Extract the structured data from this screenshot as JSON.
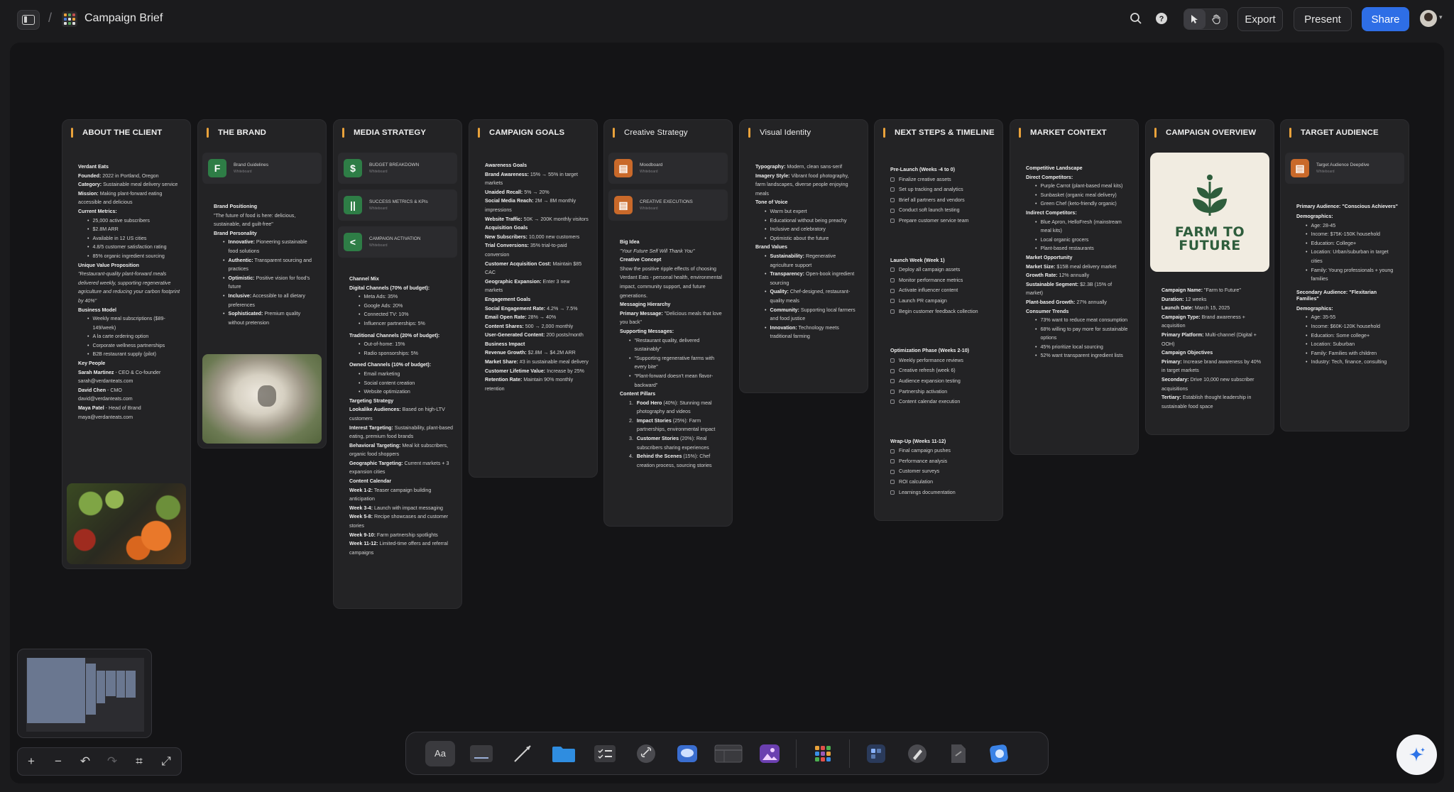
{
  "topbar": {
    "title": "Campaign Brief",
    "separator": "/",
    "export_label": "Export",
    "present_label": "Present",
    "share_label": "Share"
  },
  "cards": {
    "about": {
      "title": "ABOUT THE CLIENT",
      "lines": [
        {
          "b": "Verdant Eats",
          "t": ""
        },
        {
          "b": "Founded:",
          "t": " 2022 in Portland, Oregon"
        },
        {
          "b": "Category:",
          "t": " Sustainable meal delivery service"
        },
        {
          "b": "Mission:",
          "t": " Making plant-forward eating accessible and delicious"
        },
        {
          "b": "Current Metrics:",
          "t": ""
        }
      ],
      "metrics": [
        "25,000 active subscribers",
        "$2.8M ARR",
        "Available in 12 US cities",
        "4.8/5 customer satisfaction rating",
        "85% organic ingredient sourcing"
      ],
      "uvp_label": "Unique Value Proposition",
      "uvp_text": "\"Restaurant-quality plant-forward meals delivered weekly, supporting regenerative agriculture and reducing your carbon footprint by 40%\"",
      "bm_label": "Business Model",
      "business_model": [
        "Weekly meal subscriptions ($89-149/week)",
        "A la carte ordering option",
        "Corporate wellness partnerships",
        "B2B restaurant supply (pilot)"
      ],
      "people_label": "Key People",
      "people": [
        {
          "name": "Sarah Martinez",
          "role": " - CEO & Co-founder",
          "email": "sarah@verdanteats.com"
        },
        {
          "name": "David Chen",
          "role": " - CMO",
          "email": "david@verdanteats.com"
        },
        {
          "name": "Maya Patel",
          "role": " - Head of Brand",
          "email": "maya@verdanteats.com"
        }
      ]
    },
    "brand": {
      "title": "THE BRAND",
      "attachment": {
        "name": "Brand Guidelines",
        "type": "Whiteboard"
      },
      "positioning_label": "Brand Positioning",
      "positioning_text": "\"The future of food is here: delicious, sustainable, and guilt-free\"",
      "personality_label": "Brand Personality",
      "traits": [
        {
          "b": "Innovative:",
          "t": " Pioneering sustainable food solutions"
        },
        {
          "b": "Authentic:",
          "t": " Transparent sourcing and practices"
        },
        {
          "b": "Optimistic:",
          "t": " Positive vision for food's future"
        },
        {
          "b": "Inclusive:",
          "t": " Accessible to all dietary preferences"
        },
        {
          "b": "Sophisticated:",
          "t": " Premium quality without pretension"
        }
      ]
    },
    "media": {
      "title": "MEDIA STRATEGY",
      "attachments": [
        {
          "name": "BUDGET BREAKDOWN",
          "type": "Whiteboard",
          "icon": "$"
        },
        {
          "name": "SUCCESS METRICS & KPIs",
          "type": "Whiteboard",
          "icon": "||"
        },
        {
          "name": "CAMPAIGN ACTIVATION",
          "type": "Whiteboard",
          "icon": "<"
        }
      ],
      "channel_mix_label": "Channel Mix",
      "digital_label": "Digital Channels (70% of budget):",
      "digital": [
        "Meta Ads: 35%",
        "Google Ads: 20%",
        "Connected TV: 10%",
        "Influencer partnerships: 5%"
      ],
      "traditional_label": "Traditional Channels (20% of budget):",
      "traditional": [
        "Out-of-home: 15%",
        "Radio sponsorships: 5%"
      ],
      "owned_label": "Owned Channels (10% of budget):",
      "owned": [
        "Email marketing",
        "Social content creation",
        "Website optimization"
      ],
      "targeting_label": "Targeting Strategy",
      "targeting": [
        {
          "b": "Lookalike Audiences:",
          "t": " Based on high-LTV customers"
        },
        {
          "b": "Interest Targeting:",
          "t": " Sustainability, plant-based eating, premium food brands"
        },
        {
          "b": "Behavioral Targeting:",
          "t": " Meal kit subscribers, organic food shoppers"
        },
        {
          "b": "Geographic Targeting:",
          "t": " Current markets + 3 expansion cities"
        }
      ],
      "calendar_label": "Content Calendar",
      "calendar": [
        {
          "b": "Week 1-2:",
          "t": " Teaser campaign building anticipation"
        },
        {
          "b": "Week 3-4:",
          "t": " Launch with impact messaging"
        },
        {
          "b": "Week 5-8:",
          "t": " Recipe showcases and customer stories"
        },
        {
          "b": "Week 9-10:",
          "t": " Farm partnership spotlights"
        },
        {
          "b": "Week 11-12:",
          "t": " Limited-time offers and referral campaigns"
        }
      ]
    },
    "goals": {
      "title": "CAMPAIGN GOALS",
      "sections": [
        {
          "label": "Awareness Goals",
          "items": [
            {
              "b": "Brand Awareness:",
              "t": " 15% → 55% in target markets"
            },
            {
              "b": "Unaided Recall:",
              "t": " 5% → 20%"
            },
            {
              "b": "Social Media Reach:",
              "t": " 2M → 8M monthly impressions"
            },
            {
              "b": "Website Traffic:",
              "t": " 50K → 200K monthly visitors"
            }
          ]
        },
        {
          "label": "Acquisition Goals",
          "items": [
            {
              "b": "New Subscribers:",
              "t": " 10,000 new customers"
            },
            {
              "b": "Trial Conversions:",
              "t": " 35% trial-to-paid conversion"
            },
            {
              "b": "Customer Acquisition Cost:",
              "t": " Maintain $85 CAC"
            },
            {
              "b": "Geographic Expansion:",
              "t": " Enter 3 new markets"
            }
          ]
        },
        {
          "label": "Engagement Goals",
          "items": [
            {
              "b": "Social Engagement Rate:",
              "t": " 4.2% → 7.5%"
            },
            {
              "b": "Email Open Rate:",
              "t": " 28% → 40%"
            },
            {
              "b": "Content Shares:",
              "t": " 500 → 2,000 monthly"
            },
            {
              "b": "User-Generated Content:",
              "t": " 200 posts/month"
            }
          ]
        },
        {
          "label": "Business Impact",
          "items": [
            {
              "b": "Revenue Growth:",
              "t": " $2.8M → $4.2M ARR"
            },
            {
              "b": "Market Share:",
              "t": " #3 in sustainable meal delivery"
            },
            {
              "b": "Customer Lifetime Value:",
              "t": " Increase by 25%"
            },
            {
              "b": "Retention Rate:",
              "t": " Maintain 90% monthly retention"
            }
          ]
        }
      ]
    },
    "creative": {
      "title": "Creative Strategy",
      "attachments": [
        {
          "name": "Moodboard",
          "type": "Whiteboard"
        },
        {
          "name": "CREATIVE EXECUTIONS",
          "type": "Whiteboard"
        }
      ],
      "big_idea_label": "Big Idea",
      "big_idea": "\"Your Future Self Will Thank You\"",
      "concept_label": "Creative Concept",
      "concept": "Show the positive ripple effects of choosing Verdant Eats - personal health, environmental impact, community support, and future generations.",
      "hierarchy_label": "Messaging Hierarchy",
      "primary_b": "Primary Message:",
      "primary_t": " \"Delicious meals that love you back\"",
      "supporting_label": "Supporting Messages:",
      "supporting": [
        "\"Restaurant quality, delivered sustainably\"",
        "\"Supporting regenerative farms with every bite\"",
        "\"Plant-forward doesn't mean flavor-backward\""
      ],
      "pillars_label": "Content Pillars",
      "pillars": [
        {
          "n": "1.",
          "b": "Food Hero",
          "t": " (40%): Stunning meal photography and videos"
        },
        {
          "n": "2.",
          "b": "Impact Stories",
          "t": " (25%): Farm partnerships, environmental impact"
        },
        {
          "n": "3.",
          "b": "Customer Stories",
          "t": " (20%): Real subscribers sharing experiences"
        },
        {
          "n": "4.",
          "b": "Behind the Scenes",
          "t": " (15%): Chef creation process, sourcing stories"
        }
      ]
    },
    "visual": {
      "title": "Visual Identity",
      "top": [
        {
          "b": "Typography:",
          "t": " Modern, clean sans-serif"
        },
        {
          "b": "Imagery Style:",
          "t": " Vibrant food photography, farm landscapes, diverse people enjoying meals"
        }
      ],
      "tone_label": "Tone of Voice",
      "tone": [
        "Warm but expert",
        "Educational without being preachy",
        "Inclusive and celebratory",
        "Optimistic about the future"
      ],
      "values_label": "Brand Values",
      "values": [
        {
          "b": "Sustainability:",
          "t": " Regenerative agriculture support"
        },
        {
          "b": "Transparency:",
          "t": " Open-book ingredient sourcing"
        },
        {
          "b": "Quality:",
          "t": " Chef-designed, restaurant-quality meals"
        },
        {
          "b": "Community:",
          "t": " Supporting local farmers and food justice"
        },
        {
          "b": "Innovation:",
          "t": " Technology meets traditional farming"
        }
      ]
    },
    "nextsteps": {
      "title": "NEXT STEPS & TIMELINE",
      "phases": [
        {
          "label": "Pre-Launch (Weeks -4 to 0)",
          "items": [
            "Finalize creative assets",
            "Set up tracking and analytics",
            "Brief all partners and vendors",
            "Conduct soft launch testing",
            "Prepare customer service team"
          ]
        },
        {
          "label": "Launch Week (Week 1)",
          "items": [
            "Deploy all campaign assets",
            "Monitor performance metrics",
            "Activate influencer content",
            "Launch PR campaign",
            "Begin customer feedback collection"
          ]
        },
        {
          "label": "Optimization Phase (Weeks 2-10)",
          "items": [
            "Weekly performance reviews",
            "Creative refresh (week 6)",
            "Audience expansion testing",
            "Partnership activation",
            "Content calendar execution"
          ]
        },
        {
          "label": "Wrap-Up (Weeks 11-12)",
          "items": [
            "Final campaign pushes",
            "Performance analysis",
            "Customer surveys",
            "ROI calculation",
            "Learnings documentation"
          ]
        }
      ]
    },
    "market": {
      "title": "MARKET CONTEXT",
      "landscape_label": "Competitive Landscape",
      "direct_label": "Direct Competitors:",
      "direct": [
        "Purple Carrot (plant-based meal kits)",
        "Sunbasket (organic meal delivery)",
        "Green Chef (keto-friendly organic)"
      ],
      "indirect_label": "Indirect Competitors:",
      "indirect": [
        "Blue Apron, HelloFresh (mainstream meal kits)",
        "Local organic grocers",
        "Plant-based restaurants"
      ],
      "opportunity_label": "Market Opportunity",
      "opportunity": [
        {
          "b": "Market Size:",
          "t": " $15B meal delivery market"
        },
        {
          "b": "Growth Rate:",
          "t": " 12% annually"
        },
        {
          "b": "Sustainable Segment:",
          "t": " $2.3B (15% of market)"
        },
        {
          "b": "Plant-based Growth:",
          "t": " 27% annually"
        }
      ],
      "trends_label": "Consumer Trends",
      "trends": [
        "73% want to reduce meat consumption",
        "68% willing to pay more for sustainable options",
        "45% prioritize local sourcing",
        "52% want transparent ingredient lists"
      ]
    },
    "overview": {
      "title": "CAMPAIGN OVERVIEW",
      "logo_text_1": "FARM TO",
      "logo_text_2": "FUTURE",
      "details": [
        {
          "b": "Campaign Name:",
          "t": " \"Farm to Future\""
        },
        {
          "b": "Duration:",
          "t": " 12 weeks"
        },
        {
          "b": "Launch Date:",
          "t": " March 15, 2025"
        },
        {
          "b": "Campaign Type:",
          "t": " Brand awareness + acquisition"
        },
        {
          "b": "Primary Platform:",
          "t": " Multi-channel (Digital + OOH)"
        }
      ],
      "objectives_label": "Campaign Objectives",
      "objectives": [
        {
          "b": "Primary:",
          "t": " Increase brand awareness by 40% in target markets"
        },
        {
          "b": "Secondary:",
          "t": " Drive 10,000 new subscriber acquisitions"
        },
        {
          "b": "Tertiary:",
          "t": " Establish thought leadership in sustainable food space"
        }
      ]
    },
    "audience": {
      "title": "TARGET AUDIENCE",
      "attachment": {
        "name": "Target Audience Deepdive",
        "type": "Whiteboard"
      },
      "primary_label": "Primary Audience: \"Conscious Achievers\"",
      "demo_label": "Demographics:",
      "primary": [
        "Age: 28-45",
        "Income: $75K-150K household",
        "Education: College+",
        "Location: Urban/suburban in target cities",
        "Family: Young professionals + young families"
      ],
      "secondary_label": "Secondary Audience: \"Flexitarian Families\"",
      "secondary": [
        "Age: 35-55",
        "Income: $60K-120K household",
        "Education: Some college+",
        "Location: Suburban",
        "Family: Families with children",
        "Industry: Tech, finance, consulting"
      ]
    }
  },
  "dock": {
    "text_tool": "Aa"
  }
}
